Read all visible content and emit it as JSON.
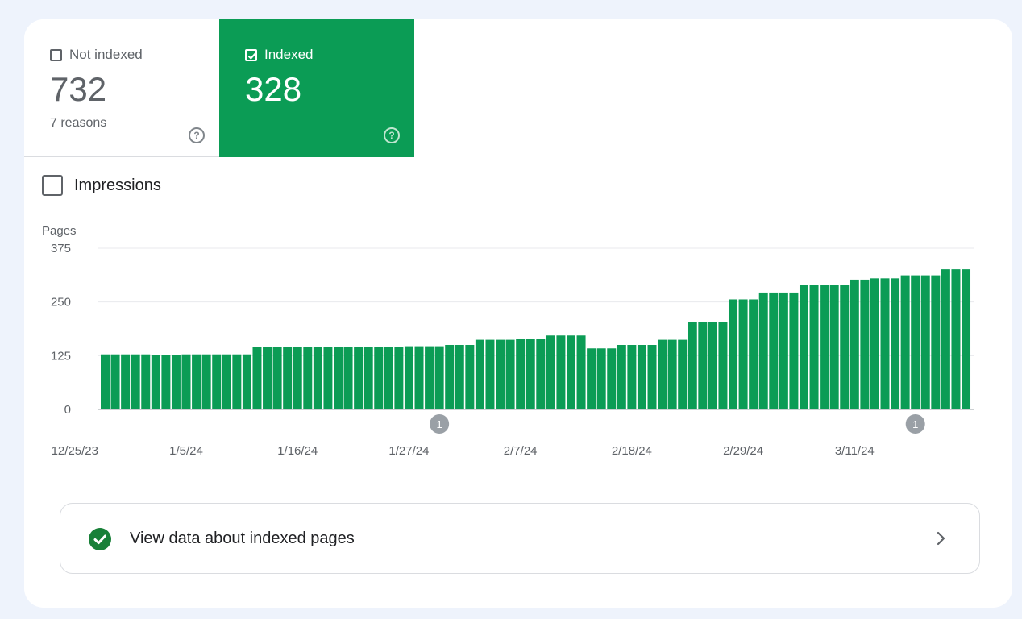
{
  "tiles": {
    "not_indexed": {
      "label": "Not indexed",
      "count": "732",
      "sub": "7 reasons",
      "help": "?"
    },
    "indexed": {
      "label": "Indexed",
      "count": "328",
      "help": "?"
    }
  },
  "impressions_label": "Impressions",
  "chart_data": {
    "type": "bar",
    "ylabel": "Pages",
    "ylim": [
      0,
      375
    ],
    "y_ticks": [
      "375",
      "250",
      "125",
      "0"
    ],
    "x_tick_labels": [
      "12/25/23",
      "1/5/24",
      "1/16/24",
      "1/27/24",
      "2/7/24",
      "2/18/24",
      "2/29/24",
      "3/11/24"
    ],
    "start_date": "12/28/23",
    "color": "#0b9c55",
    "values": [
      128,
      128,
      128,
      128,
      128,
      126,
      126,
      126,
      128,
      128,
      128,
      128,
      128,
      128,
      128,
      145,
      145,
      145,
      145,
      145,
      145,
      145,
      145,
      145,
      145,
      145,
      145,
      145,
      145,
      145,
      147,
      147,
      147,
      147,
      150,
      150,
      150,
      162,
      162,
      162,
      162,
      165,
      165,
      165,
      172,
      172,
      172,
      172,
      142,
      142,
      142,
      150,
      150,
      150,
      150,
      162,
      162,
      162,
      204,
      204,
      204,
      204,
      256,
      256,
      256,
      272,
      272,
      272,
      272,
      290,
      290,
      290,
      290,
      290,
      302,
      302,
      305,
      305,
      305,
      312,
      312,
      312,
      312,
      326,
      326,
      326
    ],
    "annotations": [
      {
        "date": "1/30/24",
        "label": "1"
      },
      {
        "date": "3/17/24",
        "label": "1"
      }
    ]
  },
  "footer_link": {
    "label": "View data about indexed pages"
  },
  "colors": {
    "accent": "#0b9c55",
    "ok": "#188038",
    "background": "#eef3fc"
  },
  "icons": {
    "help": "help-circle-icon",
    "check": "check-circle-icon",
    "chevron": "chevron-right-icon"
  }
}
